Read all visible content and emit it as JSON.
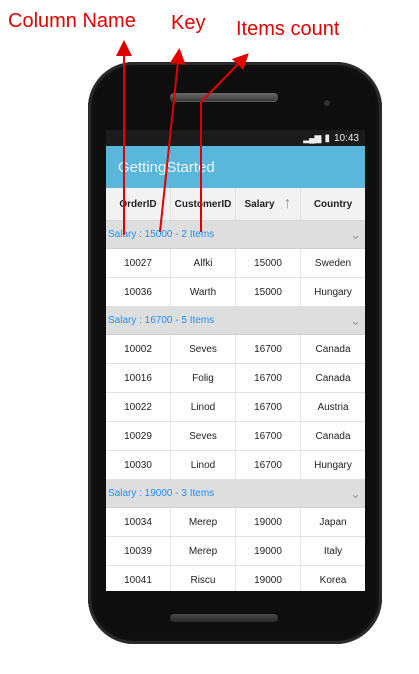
{
  "annotations": {
    "column_name": "Column Name",
    "key": "Key",
    "items_count": "Items count",
    "color": "#e00000"
  },
  "statusbar": {
    "signal": "▂▄▆",
    "battery": "▮",
    "time": "10:43"
  },
  "app": {
    "title": "GettingStarted",
    "accent": "#5bb6dc"
  },
  "grid": {
    "columns": [
      "OrderID",
      "CustomerID",
      "Salary",
      "Country"
    ],
    "sorted_column": "Salary",
    "sort_direction": "ascending",
    "sort_icon": "arrow-up-icon",
    "caption_color": "#1e90ff",
    "groups": [
      {
        "caption": "Salary : 15000 - 2 Items",
        "rows": [
          [
            "10027",
            "Alfki",
            "15000",
            "Sweden"
          ],
          [
            "10036",
            "Warth",
            "15000",
            "Hungary"
          ]
        ]
      },
      {
        "caption": "Salary : 16700 - 5 Items",
        "rows": [
          [
            "10002",
            "Seves",
            "16700",
            "Canada"
          ],
          [
            "10016",
            "Folig",
            "16700",
            "Canada"
          ],
          [
            "10022",
            "Linod",
            "16700",
            "Austria"
          ],
          [
            "10029",
            "Seves",
            "16700",
            "Canada"
          ],
          [
            "10030",
            "Linod",
            "16700",
            "Hungary"
          ]
        ]
      },
      {
        "caption": "Salary : 19000 - 3 Items",
        "rows": [
          [
            "10034",
            "Merep",
            "19000",
            "Japan"
          ],
          [
            "10039",
            "Merep",
            "19000",
            "Italy"
          ],
          [
            "10041",
            "Riscu",
            "19000",
            "Korea"
          ]
        ]
      }
    ]
  }
}
